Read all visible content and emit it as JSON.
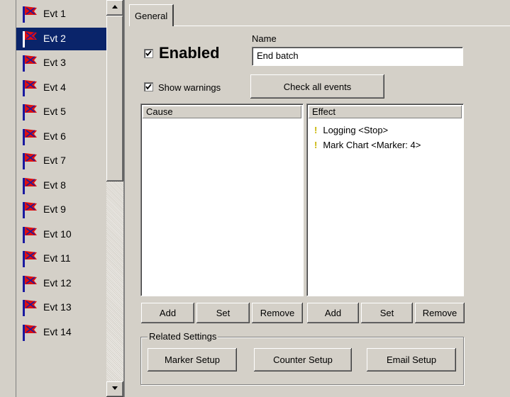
{
  "event_list": {
    "items": [
      {
        "label": "Evt 1",
        "selected": false
      },
      {
        "label": "Evt 2",
        "selected": true
      },
      {
        "label": "Evt 3",
        "selected": false
      },
      {
        "label": "Evt 4",
        "selected": false
      },
      {
        "label": "Evt 5",
        "selected": false
      },
      {
        "label": "Evt 6",
        "selected": false
      },
      {
        "label": "Evt 7",
        "selected": false
      },
      {
        "label": "Evt 8",
        "selected": false
      },
      {
        "label": "Evt 9",
        "selected": false
      },
      {
        "label": "Evt 10",
        "selected": false
      },
      {
        "label": "Evt 11",
        "selected": false
      },
      {
        "label": "Evt 12",
        "selected": false
      },
      {
        "label": "Evt 13",
        "selected": false
      },
      {
        "label": "Evt 14",
        "selected": false
      }
    ],
    "flag_icon": "event-flag-icon",
    "flag_colors": {
      "pole": "#1a1aa0",
      "flag": "#e01010"
    }
  },
  "tabs": {
    "general": "General"
  },
  "general": {
    "enabled_label": "Enabled",
    "enabled_checked": true,
    "name_label": "Name",
    "name_value": "End batch",
    "show_warnings_label": "Show warnings",
    "show_warnings_checked": true,
    "check_all_label": "Check all events",
    "cause": {
      "header": "Cause",
      "items": [],
      "add": "Add",
      "set": "Set",
      "remove": "Remove"
    },
    "effect": {
      "header": "Effect",
      "items": [
        {
          "icon": "!",
          "text": "Logging <Stop>"
        },
        {
          "icon": "!",
          "text": "Mark Chart <Marker: 4>"
        }
      ],
      "add": "Add",
      "set": "Set",
      "remove": "Remove"
    },
    "related": {
      "legend": "Related Settings",
      "marker": "Marker Setup",
      "counter": "Counter Setup",
      "email": "Email Setup"
    }
  },
  "colors": {
    "selection": "#0a246a",
    "warning": "#c8b400",
    "face": "#d4d0c8"
  }
}
